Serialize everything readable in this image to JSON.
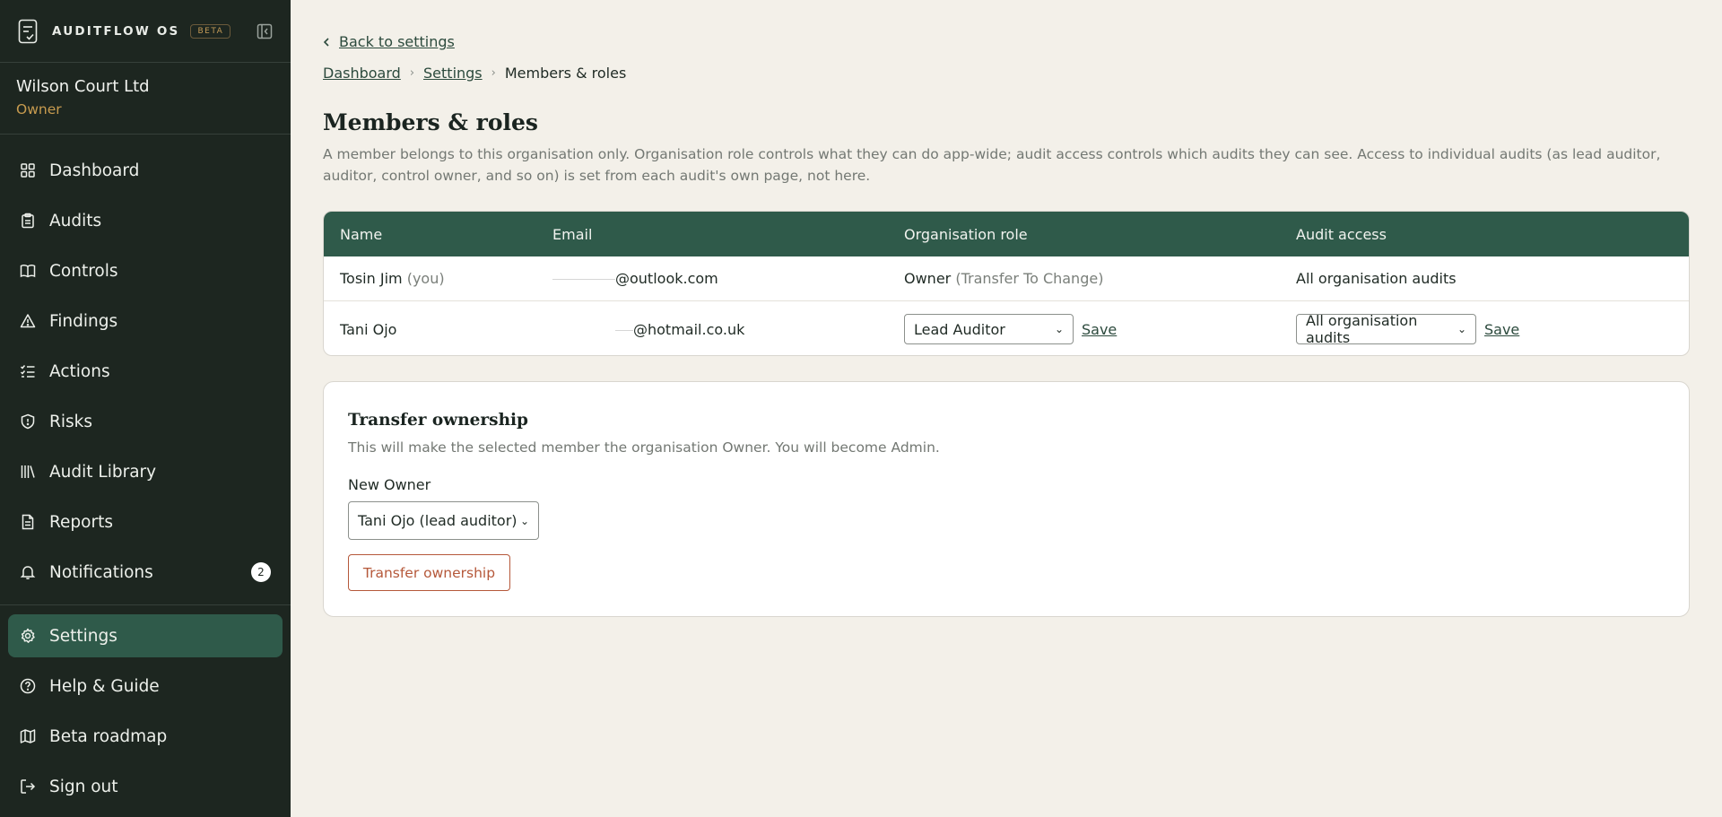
{
  "app": {
    "name": "AUDITFLOW OS",
    "badge": "BETA"
  },
  "org": {
    "name": "Wilson Court Ltd",
    "role": "Owner"
  },
  "sidebar": {
    "items": [
      {
        "label": "Dashboard",
        "icon": "grid-icon"
      },
      {
        "label": "Audits",
        "icon": "clipboard-icon"
      },
      {
        "label": "Controls",
        "icon": "book-icon"
      },
      {
        "label": "Findings",
        "icon": "warning-icon"
      },
      {
        "label": "Actions",
        "icon": "checklist-icon"
      },
      {
        "label": "Risks",
        "icon": "shield-icon"
      },
      {
        "label": "Audit Library",
        "icon": "library-icon"
      },
      {
        "label": "Reports",
        "icon": "document-icon"
      },
      {
        "label": "Notifications",
        "icon": "bell-icon",
        "badge": "2"
      }
    ],
    "bottom_items": [
      {
        "label": "Settings",
        "icon": "gear-icon",
        "active": true
      },
      {
        "label": "Help & Guide",
        "icon": "help-icon"
      },
      {
        "label": "Beta roadmap",
        "icon": "map-icon"
      },
      {
        "label": "Sign out",
        "icon": "sign-out-icon"
      }
    ]
  },
  "main": {
    "back_link": "Back to settings",
    "breadcrumb": {
      "dashboard": "Dashboard",
      "settings": "Settings",
      "current": "Members & roles"
    },
    "title": "Members & roles",
    "description": "A member belongs to this organisation only. Organisation role controls what they can do app-wide; audit access controls which audits they can see. Access to individual audits (as lead auditor, auditor, control owner, and so on) is set from each audit's own page, not here.",
    "table": {
      "headers": {
        "name": "Name",
        "email": "Email",
        "role": "Organisation role",
        "access": "Audit access"
      },
      "rows": [
        {
          "name": "Tosin Jim",
          "name_suffix": "(you)",
          "email": "@outlook.com",
          "role": "Owner",
          "role_note": "(Transfer To Change)",
          "access": "All organisation audits"
        },
        {
          "name": "Tani Ojo",
          "email": "@hotmail.co.uk",
          "role_select": "Lead Auditor",
          "role_save": "Save",
          "access_select": "All organisation audits",
          "access_save": "Save"
        }
      ]
    },
    "transfer": {
      "title": "Transfer ownership",
      "description": "This will make the selected member the organisation Owner. You will become Admin.",
      "label": "New Owner",
      "selected": "Tani Ojo (lead auditor)",
      "button": "Transfer ownership"
    }
  },
  "colors": {
    "sidebar_bg": "#1d2620",
    "accent_green": "#2f5a4a",
    "owner_gold": "#c79b4f",
    "danger": "#b5583a",
    "page_bg": "#f3f0e9"
  }
}
